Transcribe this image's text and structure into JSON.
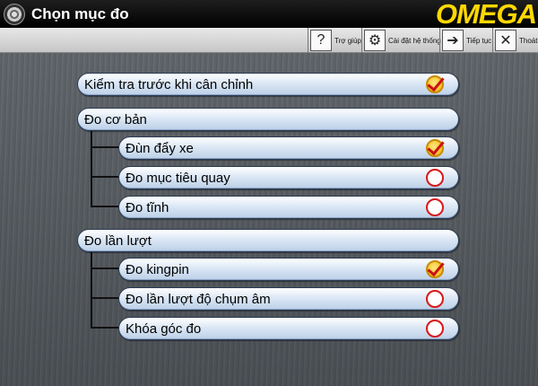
{
  "window": {
    "title": "Chọn mục đo",
    "logo": "OMEGA"
  },
  "toolbar": {
    "help_label": "Trợ giúp",
    "settings_label": "Cài đặt hệ thống",
    "next_label": "Tiếp tục",
    "exit_label": "Thoát"
  },
  "menu": {
    "precheck": {
      "label": "Kiểm tra trước khi cân chỉnh",
      "checked": true
    },
    "basic": {
      "label": "Đo cơ bản",
      "items": [
        {
          "label": "Đùn đẩy xe",
          "checked": true
        },
        {
          "label": "Đo mục tiêu quay",
          "checked": false
        },
        {
          "label": "Đo tĩnh",
          "checked": false
        }
      ]
    },
    "sequential": {
      "label": "Đo lần lượt",
      "items": [
        {
          "label": "Đo kingpin",
          "checked": true
        },
        {
          "label": "Đo lần lượt độ chụm âm",
          "checked": false
        },
        {
          "label": "Khóa góc đo",
          "checked": false
        }
      ]
    }
  },
  "colors": {
    "accent": "#ffd800",
    "pill_border": "#2a3a52",
    "radio_off": "#d81818"
  }
}
